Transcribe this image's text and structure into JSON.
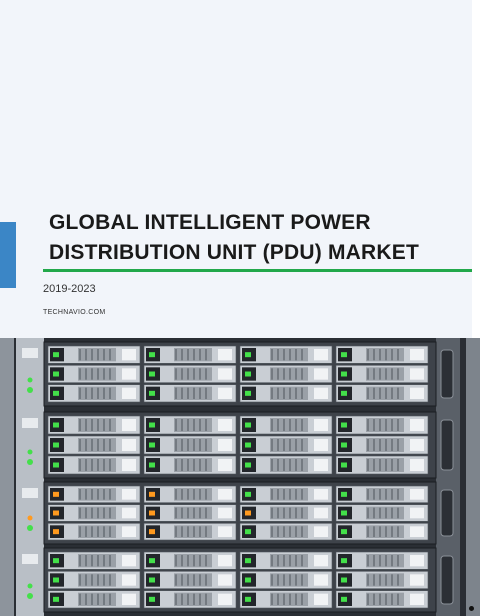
{
  "cover": {
    "title_line1": "GLOBAL INTELLIGENT POWER",
    "title_line2": "DISTRIBUTION UNIT (PDU) MARKET",
    "years": "2019-2023",
    "brand": "TECHNAVIO.COM"
  },
  "colors": {
    "accent_blue": "#3b86c6",
    "accent_green": "#22a84a",
    "background": "#f2f5fa"
  },
  "image": {
    "subject": "server-rack-photo"
  }
}
